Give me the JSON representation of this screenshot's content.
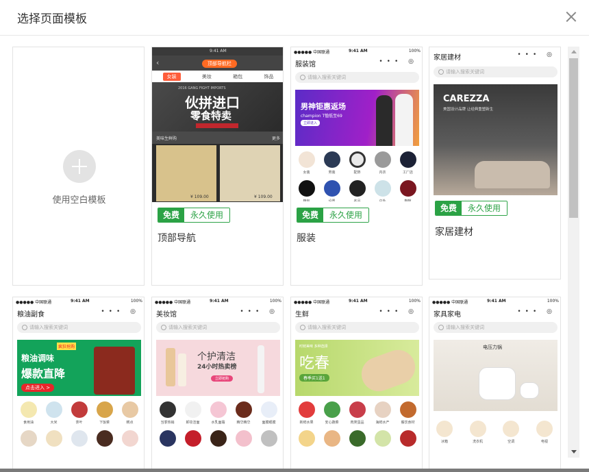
{
  "dialog": {
    "title": "选择页面模板",
    "close_label": "×"
  },
  "blank": {
    "label": "使用空白模板"
  },
  "badge": {
    "free": "免费",
    "permanent": "永久使用"
  },
  "status": {
    "carrier": "●●●●● 中国联通",
    "time": "9:41 AM",
    "battery": "100%"
  },
  "common": {
    "search_placeholder": "请输入搜索关键词",
    "caps": "••• ◎"
  },
  "templates": [
    {
      "name": "顶部导航",
      "top_tag": "顶部导航栏",
      "tabs": [
        "女装",
        "美妆",
        "箱包",
        "饰品"
      ],
      "banner_line1": "伙拼进口",
      "banner_line2": "零食特卖",
      "banner_sub": "2016 GANG FIGHT IMPORTS",
      "section": "美味生鲜购",
      "section_more": "更多",
      "price1": "¥ 109.00",
      "price2": "¥ 109.00"
    },
    {
      "name": "服装",
      "app_title": "服装馆",
      "banner_line1": "男神钜惠返场",
      "banner_sub": "champion T恤低至69",
      "banner_btn": "立即进入",
      "icons": [
        "女装",
        "男装",
        "配饰",
        "内衣",
        "工厂店",
        "箱包",
        "设置",
        "名品",
        "户外",
        "鞋靴"
      ]
    },
    {
      "name": "家居建材",
      "app_title": "家居建材",
      "banner_brand": "CAREZZA",
      "banner_sub": "美国设计品牌 让经典重塑新生"
    },
    {
      "app_title": "粮油副食",
      "banner_line1": "粮油调味",
      "banner_line2": "爆款直降",
      "banner_badge": "疯狂抢购",
      "banner_btn": "点击进入 >",
      "icons": [
        "食用油",
        "大米",
        "茶叶",
        "下饭菜",
        "糕点",
        "",
        "",
        "",
        "",
        ""
      ]
    },
    {
      "app_title": "美妆馆",
      "banner_line1": "个护清洁",
      "banner_line2": "24小时热卖榜",
      "banner_btn": "立即抢购",
      "icons": [
        "当季热销",
        "卸妆洁面",
        "水乳面霜",
        "精华精华",
        "面膜眼膜",
        "",
        "",
        "",
        "",
        ""
      ]
    },
    {
      "app_title": "生鲜",
      "banner_line1": "吃春",
      "banner_sub": "时鲜美味 多种选择",
      "banner_btn": "春季买1送1",
      "icons": [
        "新鲜水果",
        "安心蔬菜",
        "肉类蛋品",
        "海鲜水产",
        "餐饮食材",
        "",
        "",
        "",
        "",
        ""
      ]
    },
    {
      "app_title": "家具家电",
      "banner_line1": "电压力锅",
      "icons": [
        "冰箱",
        "洗衣机",
        "空调",
        "电视"
      ]
    }
  ],
  "colors": {
    "accent": "#2ba245",
    "tab_active": "#ff5d3b"
  }
}
